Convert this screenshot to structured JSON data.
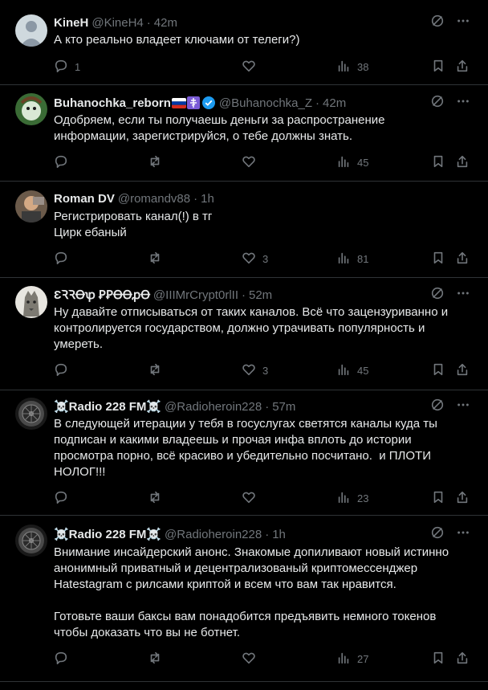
{
  "tweets": [
    {
      "name": "KineH",
      "handle": "@KineH4",
      "sep": "·",
      "time": "42m",
      "text": "А кто реально владеет ключами от телеги?)",
      "replies": "1",
      "retweets": "",
      "likes": "",
      "views": "38"
    },
    {
      "name": "Buhanochka_reborn",
      "handle": "@Buhanochka_Z",
      "sep": "·",
      "time": "42m",
      "text": "Одобряем, если ты получаешь деньги за распространение информации, зарегистрируйся, о тебе должны знать.",
      "replies": "",
      "retweets": "",
      "likes": "",
      "views": "45"
    },
    {
      "name": "Roman DV",
      "handle": "@romandv88",
      "sep": "·",
      "time": "1h",
      "text": "Регистрировать канал(!) в тг\nЦирк ебаный",
      "replies": "",
      "retweets": "",
      "likes": "3",
      "views": "81"
    },
    {
      "name": "ƐꝚꝚꝊꝕ ꝐꝐꝊꝊꝓꝊ",
      "handle": "@IIIMrCrypt0rlII",
      "sep": "·",
      "time": "52m",
      "text": "Ну давайте отписываться от таких каналов. Всё что зацензуриванно и контролируется государством, должно утрачивать популярность и умереть.",
      "replies": "",
      "retweets": "",
      "likes": "3",
      "views": "45"
    },
    {
      "name": "☠️Radio 228 FM☠️",
      "handle": "@Radioheroin228",
      "sep": "·",
      "time": "57m",
      "text": "В следующей итерации у тебя в госуслугах светятся каналы куда ты подписан и какими владеешь и прочая инфа вплоть до истории просмотра порно, всё красиво и убедительно посчитано.  и ПЛОТИ НОЛОГ!!!",
      "replies": "",
      "retweets": "",
      "likes": "",
      "views": "23"
    },
    {
      "name": "☠️Radio 228 FM☠️",
      "handle": "@Radioheroin228",
      "sep": "·",
      "time": "1h",
      "text": "Внимание инсайдерский анонс. Знакомые допиливают новый истинно анонимный приватный и децентрализованый криптомессенджер Hatestagram с рилсами криптой и всем что вам так нравится.\n\nГотовьте ваши баксы вам понадобится предъявить немного токенов чтобы доказать что вы не ботнет.",
      "replies": "",
      "retweets": "",
      "likes": "",
      "views": "27"
    }
  ],
  "icons": {
    "reply": "reply-icon",
    "retweet": "retweet-icon",
    "like": "heart-icon",
    "views": "views-icon",
    "bookmark": "bookmark-icon",
    "share": "share-icon",
    "grok": "grok-icon",
    "more": "more-icon"
  },
  "colors": {
    "background": "#000000",
    "text": "#e7e9ea",
    "muted": "#71767b",
    "divider": "#2f3336",
    "verified": "#1d9bf0"
  }
}
